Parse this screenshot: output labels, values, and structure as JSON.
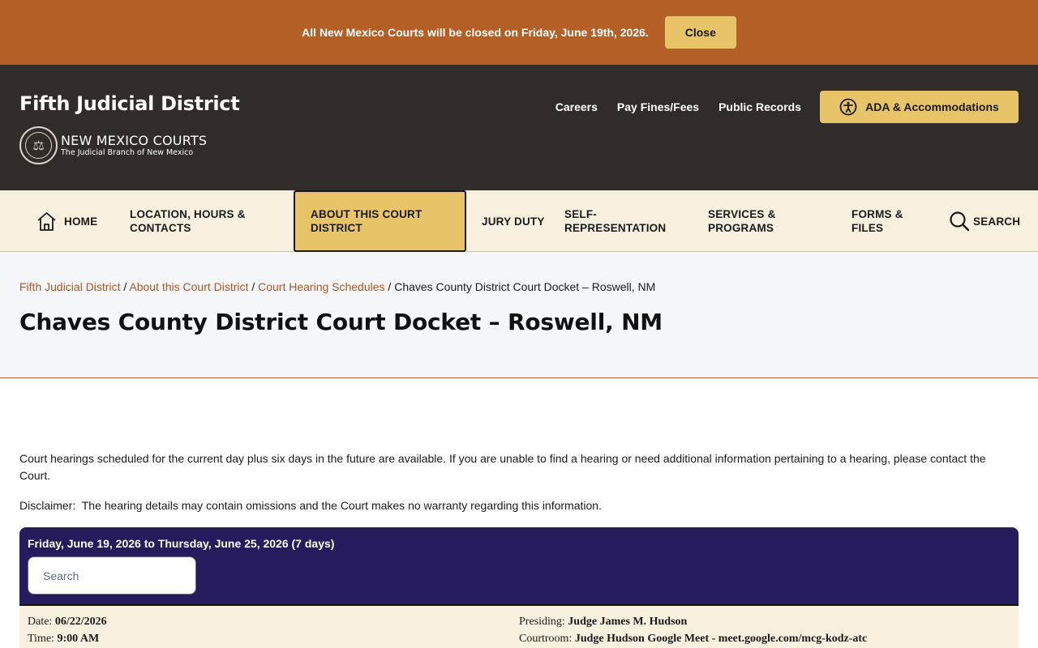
{
  "alert": {
    "message": "All New Mexico Courts will be closed on Friday, June 19th, 2026.",
    "close_label": "Close"
  },
  "header": {
    "site_title": "Fifth Judicial District",
    "brand_name": "NEW MEXICO COURTS",
    "brand_sub": "The Judicial Branch of New Mexico",
    "util_links": [
      "Careers",
      "Pay Fines/Fees",
      "Public Records"
    ],
    "ada_label": "ADA & Accommodations"
  },
  "nav": {
    "home": "HOME",
    "location": "LOCATION, HOURS & CONTACTS",
    "about": "ABOUT THIS COURT DISTRICT",
    "jury": "JURY DUTY",
    "self_rep": "SELF-REPRESENTATION",
    "services": "SERVICES & PROGRAMS",
    "forms": "FORMS & FILES",
    "search": "SEARCH"
  },
  "breadcrumb": {
    "items": [
      "Fifth Judicial District",
      "About this Court District",
      "Court Hearing Schedules"
    ],
    "separator": "/",
    "current": "Chaves County District Court Docket – Roswell, NM"
  },
  "page_title": "Chaves County District Court Docket – Roswell, NM",
  "intro": "Court hearings scheduled for the current day plus six days in the future are available. If you are unable to find a hearing or need additional information pertaining to a hearing, please contact the Court.",
  "disclaimer": "Disclaimer:  The hearing details may contain omissions and the Court makes no warranty regarding this information.",
  "docket": {
    "range": "Friday, June 19, 2026 to Thursday, June 25, 2026 (7 days)",
    "search_placeholder": "Search",
    "entry": {
      "date_label": "Date:",
      "date": "06/22/2026",
      "time_label": "Time:",
      "time": "9:00 AM",
      "presiding_label": "Presiding:",
      "presiding": "Judge James M. Hudson",
      "courtroom_label": "Courtroom:",
      "courtroom": "Judge Hudson Google Meet - meet.google.com/mcg-kodz-atc"
    }
  },
  "colors": {
    "alert_bg": "#b35f26",
    "header_bg": "#312c29",
    "accent_gold": "#e8c468",
    "nav_bg": "#f8f0df",
    "docket_bg": "#261b5c",
    "link": "#a6582a"
  }
}
